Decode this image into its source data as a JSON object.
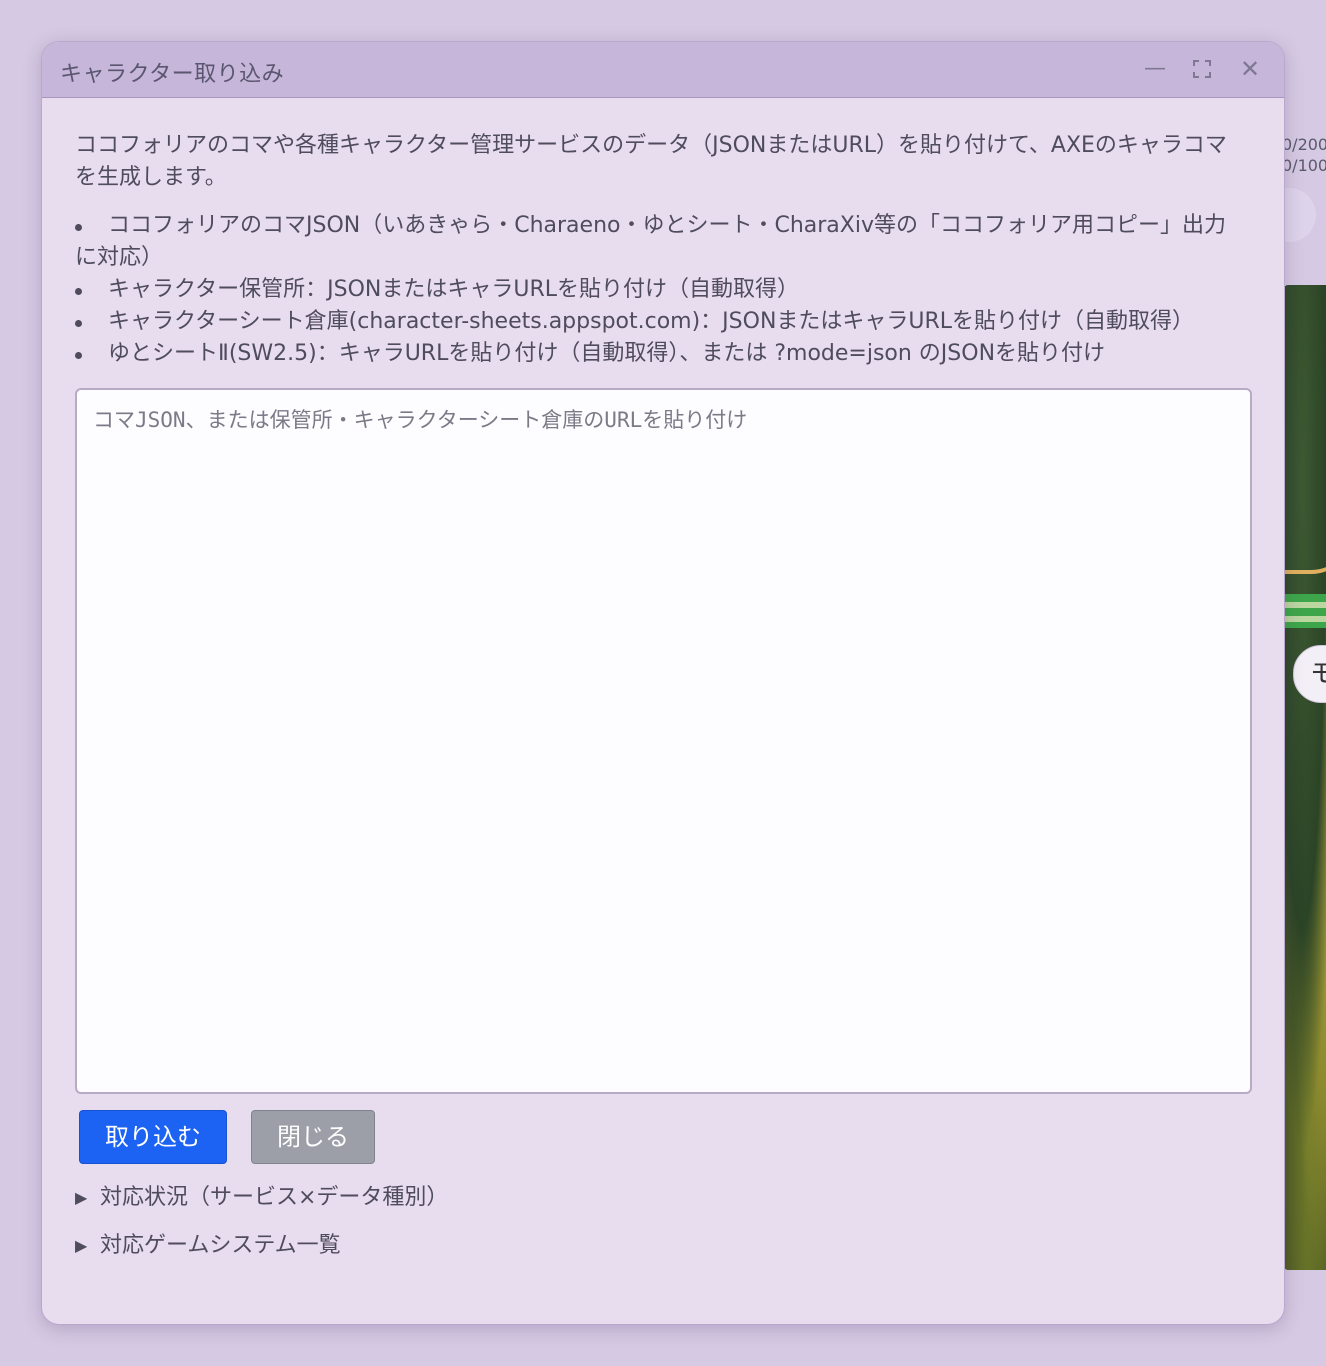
{
  "background": {
    "counter_1": "0/200",
    "counter_2": "0/100",
    "pill_label": "モ"
  },
  "dialog": {
    "title": "キャラクター取り込み",
    "controls": {
      "minimize_glyph": "—",
      "maximize_glyph": "⛶",
      "close_glyph": "✕"
    },
    "intro": "ココフォリアのコマや各種キャラクター管理サービスのデータ（JSONまたはURL）を貼り付けて、AXEのキャラコマを生成します。",
    "support_items": [
      "ココフォリアのコマJSON（いあきゃら・Charaeno・ゆとシート・CharaXiv等の「ココフォリア用コピー」出力に対応）",
      "キャラクター保管所：JSONまたはキャラURLを貼り付け（自動取得）",
      "キャラクターシート倉庫(character-sheets.appspot.com)：JSONまたはキャラURLを貼り付け（自動取得）",
      "ゆとシートⅡ(SW2.5)：キャラURLを貼り付け（自動取得）、または ?mode=json のJSONを貼り付け"
    ],
    "input": {
      "value": "",
      "placeholder": "コマJSON、または保管所・キャラクターシート倉庫のURLを貼り付け"
    },
    "buttons": {
      "import_label": "取り込む",
      "close_label": "閉じる"
    },
    "sections": [
      {
        "label": "対応状況（サービス×データ種別）"
      },
      {
        "label": "対応ゲームシステム一覧"
      }
    ],
    "disclosure_glyph": "▶"
  },
  "colors": {
    "primary_button": "#1d63f3",
    "secondary_button": "#9c9fa8",
    "dialog_bg": "#e8dcef",
    "titlebar_bg": "#c6b6d9"
  }
}
